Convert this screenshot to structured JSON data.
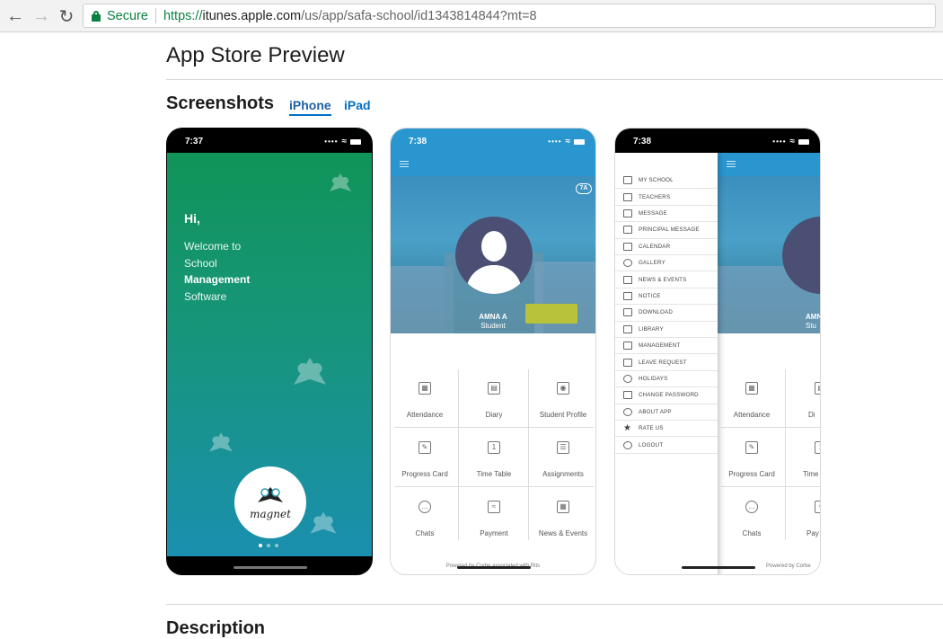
{
  "browser": {
    "back_icon": "arrow-left-icon",
    "forward_icon": "arrow-right-icon",
    "reload_icon": "reload-icon",
    "secure_label": "Secure",
    "url_scheme": "https://",
    "url_host": "itunes.apple.com",
    "url_path": "/us/app/safa-school/id1343814844?mt=8"
  },
  "page": {
    "title": "App Store Preview",
    "section_title": "Screenshots",
    "tabs": [
      {
        "label": "iPhone",
        "active": true
      },
      {
        "label": "iPad",
        "active": false
      }
    ],
    "next_section_title": "Description"
  },
  "phone1": {
    "time": "7:37",
    "greeting": "Hi,",
    "welcome_line1": "Welcome to",
    "welcome_line2": "School",
    "welcome_bold": "Management",
    "welcome_line4": "Software",
    "logo_text": "magnet"
  },
  "phone2": {
    "time": "7:38",
    "class_badge": "7A",
    "student_name": "AMNA A",
    "student_role": "Student",
    "tiles": [
      {
        "label": "Attendance",
        "icon": "attendance-icon"
      },
      {
        "label": "Diary",
        "icon": "diary-icon"
      },
      {
        "label": "Student Profile",
        "icon": "student-profile-icon"
      },
      {
        "label": "Progress Card",
        "icon": "progress-card-icon"
      },
      {
        "label": "Time Table",
        "icon": "time-table-icon"
      },
      {
        "label": "Assignments",
        "icon": "assignments-icon"
      },
      {
        "label": "Chats",
        "icon": "chats-icon"
      },
      {
        "label": "Payment",
        "icon": "payment-icon"
      },
      {
        "label": "News & Events",
        "icon": "news-events-icon"
      }
    ],
    "powered_by": "Powered by Corbe associated with Rits"
  },
  "phone3": {
    "time": "7:38",
    "menu": [
      "MY SCHOOL",
      "TEACHERS",
      "MESSAGE",
      "PRINCIPAL MESSAGE",
      "CALENDAR",
      "GALLERY",
      "NEWS & EVENTS",
      "NOTICE",
      "DOWNLOAD",
      "LIBRARY",
      "MANAGEMENT",
      "LEAVE REQUEST",
      "HOLIDAYS",
      "CHANGE PASSWORD",
      "ABOUT APP",
      "RATE US",
      "LOGOUT"
    ],
    "underlay_name": "AMN",
    "underlay_role": "Stu",
    "underlay_tiles": [
      "Attendance",
      "Di",
      "Progress Card",
      "Time",
      "Chats",
      "Pay"
    ],
    "powered_by": "Powered by Corbe"
  }
}
